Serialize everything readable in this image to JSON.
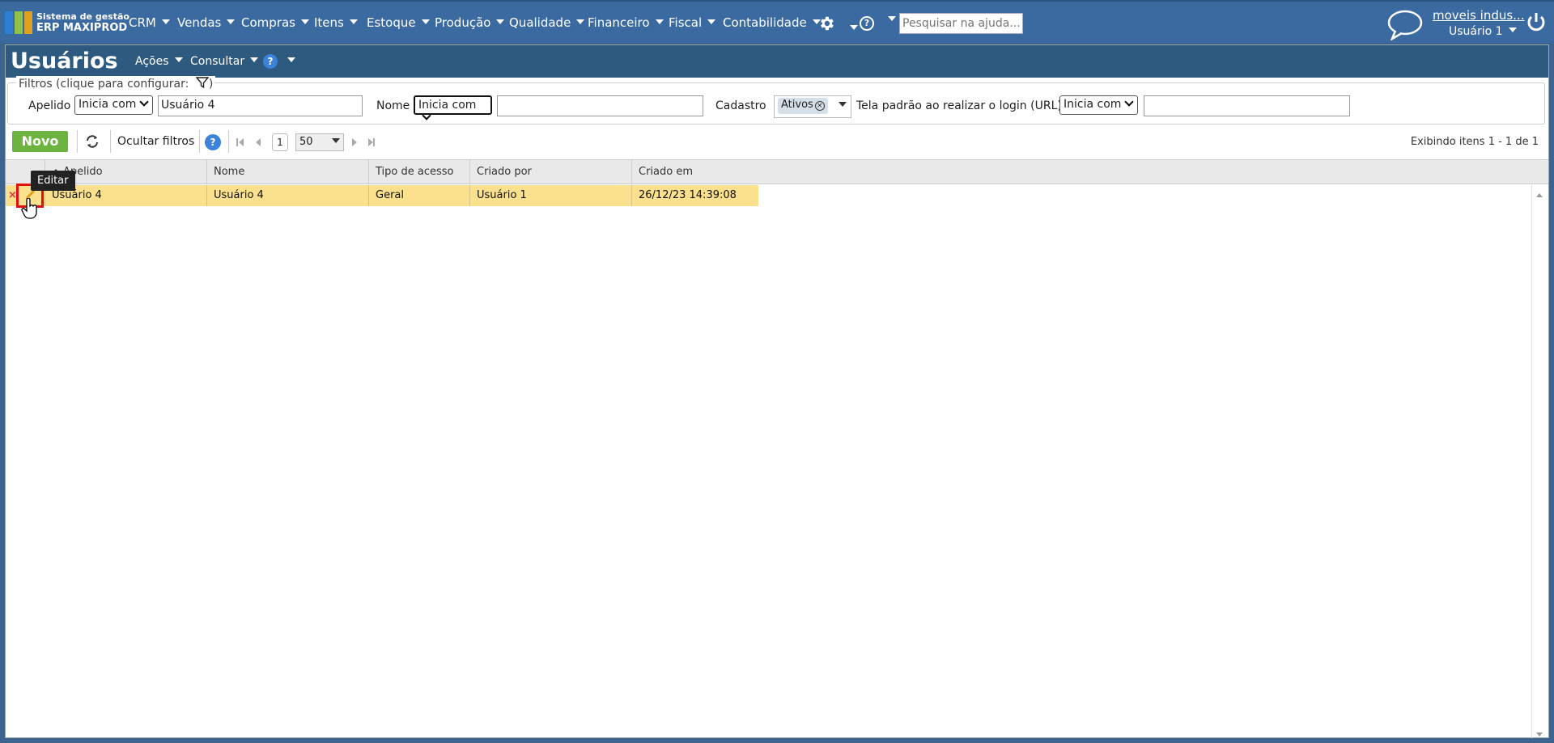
{
  "app": {
    "logo_line1": "Sistema de gestão",
    "logo_line2": "ERP MAXIPROD"
  },
  "nav": {
    "items": [
      "CRM",
      "Vendas",
      "Compras",
      "Itens",
      "Estoque",
      "Produção",
      "Qualidade",
      "Financeiro",
      "Fiscal",
      "Contabilidade"
    ],
    "help_search_placeholder": "Pesquisar na ajuda...",
    "company_link": "moveis indus...",
    "user_menu": "Usuário 1"
  },
  "page": {
    "title": "Usuários",
    "menus": [
      "Ações",
      "Consultar"
    ]
  },
  "filters": {
    "legend": "Filtros (clique para configurar:",
    "legend_close": ")",
    "apelido_label": "Apelido",
    "apelido_mode": "Inicia com",
    "apelido_value": "Usuário 4",
    "nome_label": "Nome",
    "nome_mode": "Inicia com",
    "nome_value": "",
    "cadastro_label": "Cadastro",
    "cadastro_chip": "Ativos",
    "url_label": "Tela padrão ao realizar o login (URL)",
    "url_mode": "Inicia com",
    "url_value": ""
  },
  "toolbar": {
    "new_label": "Novo",
    "hide_filters_label": "Ocultar filtros",
    "page_number": "1",
    "page_size": "50",
    "records_info": "Exibindo itens 1 - 1 de 1"
  },
  "grid": {
    "columns": [
      "Apelido",
      "Nome",
      "Tipo de acesso",
      "Criado por",
      "Criado em"
    ],
    "rows": [
      {
        "apelido": "Usuário 4",
        "nome": "Usuário 4",
        "tipo": "Geral",
        "criado_por": "Usuário 1",
        "criado_em": "26/12/23 14:39:08"
      }
    ],
    "sort_column": "Apelido",
    "sort_direction": "ascending"
  },
  "tooltip": {
    "text": "Editar"
  },
  "colors": {
    "topbar": "#3a6a9f",
    "titlebar": "#2d5a7e",
    "new_button": "#6db33f",
    "selected_row": "#fbe08d",
    "highlight": "#e01010"
  },
  "icons": [
    "gear-icon",
    "help-icon",
    "chat-icon",
    "power-icon",
    "filter-icon",
    "refresh-icon",
    "edit-icon",
    "delete-icon",
    "sort-asc-icon"
  ]
}
